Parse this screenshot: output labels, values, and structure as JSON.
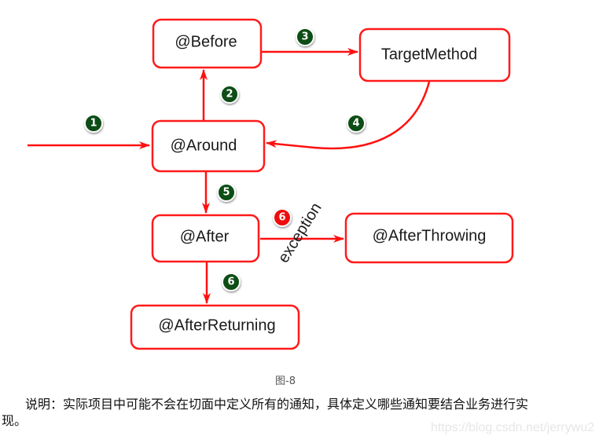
{
  "diagram": {
    "colors": {
      "edge": "#ff1010",
      "node_border": "#ff1a1a",
      "badge_normal": "#0d4d12",
      "badge_exception": "#ee1111"
    },
    "nodes": [
      {
        "id": "before",
        "label": "@Before"
      },
      {
        "id": "target",
        "label": "TargetMethod"
      },
      {
        "id": "around",
        "label": "@Around"
      },
      {
        "id": "after",
        "label": "@After"
      },
      {
        "id": "after_throwing",
        "label": "@AfterThrowing"
      },
      {
        "id": "after_returning",
        "label": "@AfterReturning"
      }
    ],
    "edges": [
      {
        "from": "entry",
        "to": "around",
        "step": "1",
        "kind": "normal"
      },
      {
        "from": "around",
        "to": "before",
        "step": "2",
        "kind": "normal"
      },
      {
        "from": "before",
        "to": "target",
        "step": "3",
        "kind": "normal"
      },
      {
        "from": "target",
        "to": "around",
        "step": "4",
        "kind": "normal"
      },
      {
        "from": "around",
        "to": "after",
        "step": "5",
        "kind": "normal"
      },
      {
        "from": "after",
        "to": "after_throwing",
        "step": "6",
        "kind": "exception",
        "label": "exception"
      },
      {
        "from": "after",
        "to": "after_returning",
        "step": "6",
        "kind": "normal"
      }
    ]
  },
  "caption": "图-8",
  "description": "说明：实际项目中可能不会在切面中定义所有的通知，具体定义哪些通知要结合业务进行实现。",
  "watermark": "https://blog.csdn.net/jerrywu2"
}
